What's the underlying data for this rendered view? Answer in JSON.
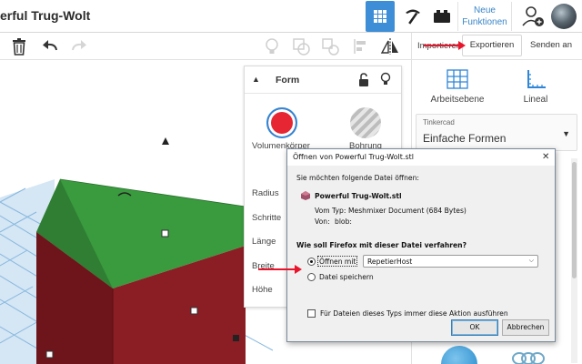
{
  "app": {
    "title": "erful Trug-Wolt"
  },
  "topbar": {
    "new_features_line1": "Neue",
    "new_features_line2": "Funktionen"
  },
  "header": {
    "import_label": "Importieren",
    "export_label": "Exportieren",
    "send_label": "Senden an"
  },
  "sidebar": {
    "workplane_label": "Arbeitsebene",
    "ruler_label": "Lineal",
    "library": {
      "caption": "Tinkercad",
      "value": "Einfache Formen"
    }
  },
  "shape_panel": {
    "title": "Form",
    "solid_label": "Volumenkörper",
    "hole_label": "Bohrung",
    "fields": [
      "Radius",
      "Schritte",
      "Länge",
      "Breite",
      "Höhe"
    ]
  },
  "dialog": {
    "title": "Öffnen von Powerful Trug-Wolt.stl",
    "intro": "Sie möchten folgende Datei öffnen:",
    "filename": "Powerful Trug-Wolt.stl",
    "type_label": "Vom Typ:",
    "type_value": "Meshmixer Document (684 Bytes)",
    "from_label": "Von:",
    "from_value": "blob:",
    "question": "Wie soll Firefox mit dieser Datei verfahren?",
    "open_with_label": "Öffnen mit",
    "open_with_app": "RepetierHost",
    "save_label": "Datei speichern",
    "remember_label": "Für Dateien dieses Typs immer diese Aktion ausführen",
    "ok_label": "OK",
    "cancel_label": "Abbrechen"
  },
  "colors": {
    "accent": "#3d8ed6",
    "roof": "#3a9a3e",
    "wall": "#8b1d24",
    "grid": "#87b8df",
    "annotation": "#e8142c"
  }
}
